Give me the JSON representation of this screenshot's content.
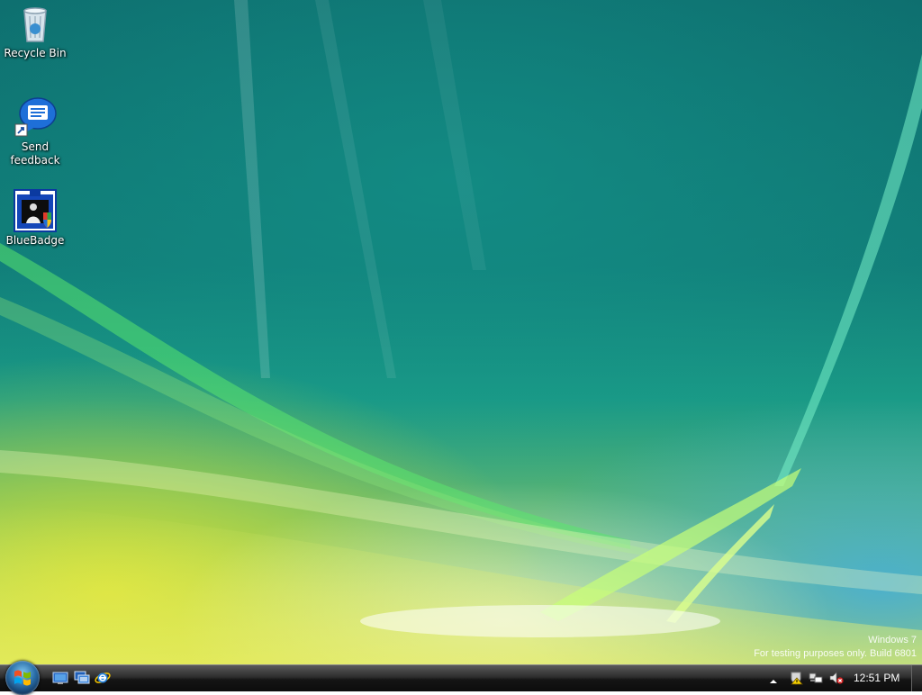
{
  "desktop": {
    "icons": [
      {
        "label": "Recycle Bin",
        "icon": "recycle-bin-icon"
      },
      {
        "label": "Send feedback",
        "icon": "feedback-bubble-icon"
      },
      {
        "label": "BlueBadge",
        "icon": "bluebadge-icon"
      }
    ],
    "watermark": {
      "line1": "Windows 7",
      "line2": "For testing purposes only. Build 6801"
    }
  },
  "taskbar": {
    "start_icon": "windows-logo-icon",
    "quick_launch": [
      {
        "icon": "show-desktop-icon"
      },
      {
        "icon": "switch-windows-icon"
      },
      {
        "icon": "internet-explorer-icon"
      }
    ],
    "tray": {
      "icons": [
        "show-hidden-icons-arrow-icon",
        "action-center-warning-icon",
        "network-icon",
        "volume-muted-icon"
      ],
      "clock": "12:51 PM"
    }
  },
  "colors": {
    "wallpaper_teal": "#0e6f6f",
    "wallpaper_green": "#7cc36a",
    "wallpaper_yellow": "#c9d84a",
    "taskbar": "#151515"
  }
}
